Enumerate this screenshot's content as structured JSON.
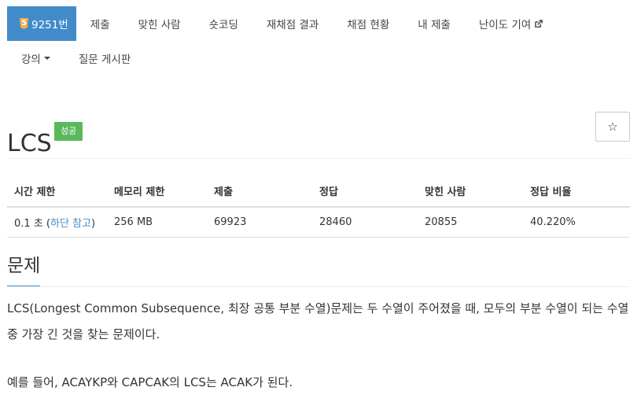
{
  "nav": {
    "problem_number": "9251번",
    "problem_icon_digit": "5",
    "items": [
      "제출",
      "맞힌 사람",
      "숏코딩",
      "재채점 결과",
      "채점 현황",
      "내 제출",
      "난이도 기여"
    ],
    "lecture": "강의",
    "qna": "질문 게시판"
  },
  "title": {
    "text": "LCS",
    "badge": "성공",
    "star": "☆"
  },
  "info": {
    "headers": [
      "시간 제한",
      "메모리 제한",
      "제출",
      "정답",
      "맞힌 사람",
      "정답 비율"
    ],
    "time_value": "0.1 초 (",
    "time_link": "하단 참고",
    "time_close": ")",
    "memory": "256 MB",
    "submissions": "69923",
    "accepted": "28460",
    "solvers": "20855",
    "ratio": "40.220%"
  },
  "section": {
    "title": "문제",
    "p1": "LCS(Longest Common Subsequence, 최장 공통 부분 수열)문제는 두 수열이 주어졌을 때, 모두의 부분 수열이 되는 수열 중 가장 긴 것을 찾는 문제이다.",
    "p2": "예를 들어, ACAYKP와 CAPCAK의 LCS는 ACAK가 된다."
  },
  "colors": {
    "active_tab": "#428bca",
    "success_badge": "#5cb85c",
    "link": "#428bca"
  }
}
